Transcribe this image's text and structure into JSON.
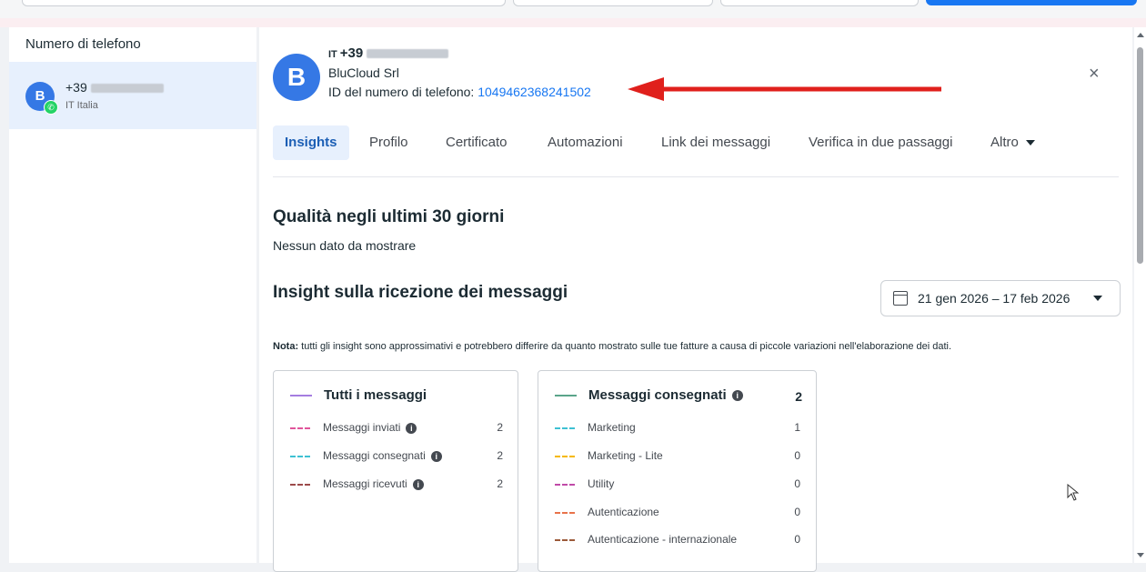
{
  "sidebar": {
    "title": "Numero di telefono",
    "item": {
      "avatar_letter": "B",
      "number_prefix": "+39",
      "country": "IT Italia",
      "badge_icon": "whatsapp-icon"
    }
  },
  "header": {
    "avatar_letter": "B",
    "country_code": "IT",
    "number_prefix": "+39",
    "company": "BluCloud Srl",
    "id_label": "ID del numero di telefono: ",
    "id_value": "1049462368241502",
    "close_label": "×"
  },
  "tabs": [
    {
      "label": "Insights",
      "active": true
    },
    {
      "label": "Profilo"
    },
    {
      "label": "Certificato"
    },
    {
      "label": "Automazioni"
    },
    {
      "label": "Link dei messaggi"
    },
    {
      "label": "Verifica in due passaggi"
    },
    {
      "label": "Altro"
    }
  ],
  "quality": {
    "title": "Qualità negli ultimi 30 giorni",
    "subtitle": "Nessun dato da mostrare"
  },
  "insights": {
    "title": "Insight sulla ricezione dei messaggi",
    "date_range": "21 gen 2026 – 17 feb 2026",
    "note_label": "Nota:",
    "note_text": " tutti gli insight sono approssimativi e potrebbero differire da quanto mostrato sulle tue fatture a causa di piccole variazioni nell'elaborazione dei dati."
  },
  "card_all": {
    "title": "Tutti i messaggi",
    "color": "#a57de0",
    "rows": [
      {
        "label": "Messaggi inviati",
        "value": "2",
        "color": "#e0559b"
      },
      {
        "label": "Messaggi consegnati",
        "value": "2",
        "color": "#3ec1d3"
      },
      {
        "label": "Messaggi ricevuti",
        "value": "2",
        "color": "#9c4a4a"
      }
    ]
  },
  "card_delivered": {
    "title": "Messaggi consegnati",
    "value": "2",
    "color": "#5aa58a",
    "rows": [
      {
        "label": "Marketing",
        "value": "1",
        "color": "#3ec1d3"
      },
      {
        "label": "Marketing - Lite",
        "value": "0",
        "color": "#f5b800"
      },
      {
        "label": "Utility",
        "value": "0",
        "color": "#c04aa8"
      },
      {
        "label": "Autenticazione",
        "value": "0",
        "color": "#e8734a"
      },
      {
        "label": "Autenticazione - internazionale",
        "value": "0",
        "color": "#9c5a3a"
      }
    ]
  },
  "colors": {
    "accent": "#1877f2",
    "arrow": "#e0201c"
  }
}
